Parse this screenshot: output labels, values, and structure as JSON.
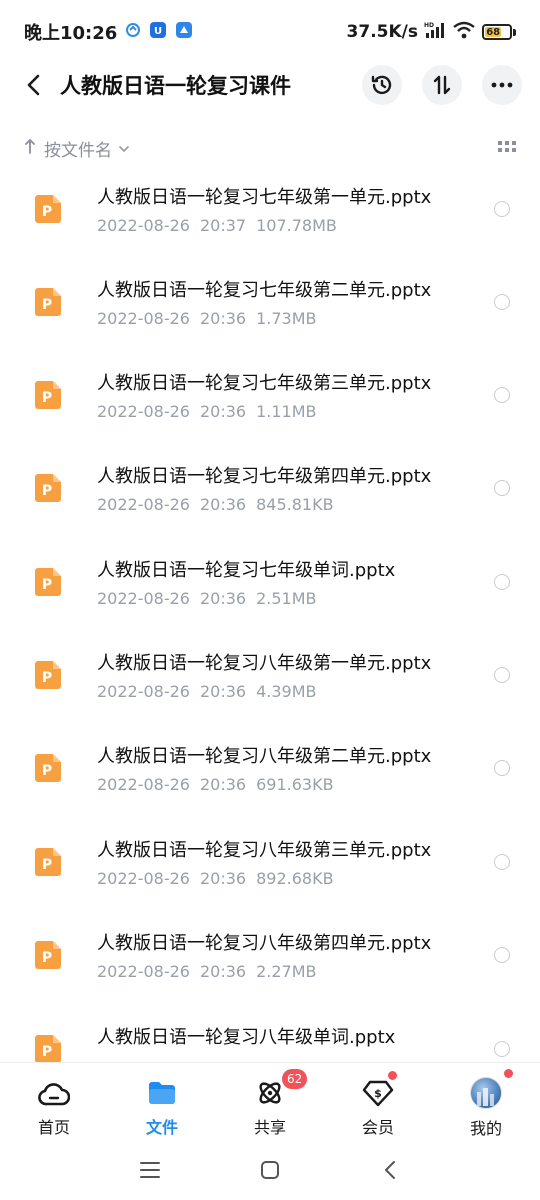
{
  "status_bar": {
    "time": "晚上10:26",
    "net_speed": "37.5K/s",
    "battery": "68"
  },
  "header": {
    "title": "人教版日语一轮复习课件"
  },
  "sort": {
    "label": "按文件名"
  },
  "files": [
    {
      "name": "人教版日语一轮复习七年级第一单元.pptx",
      "date": "2022-08-26",
      "time": "20:37",
      "size": "107.78MB"
    },
    {
      "name": "人教版日语一轮复习七年级第二单元.pptx",
      "date": "2022-08-26",
      "time": "20:36",
      "size": "1.73MB"
    },
    {
      "name": "人教版日语一轮复习七年级第三单元.pptx",
      "date": "2022-08-26",
      "time": "20:36",
      "size": "1.11MB"
    },
    {
      "name": "人教版日语一轮复习七年级第四单元.pptx",
      "date": "2022-08-26",
      "time": "20:36",
      "size": "845.81KB"
    },
    {
      "name": "人教版日语一轮复习七年级单词.pptx",
      "date": "2022-08-26",
      "time": "20:36",
      "size": "2.51MB"
    },
    {
      "name": "人教版日语一轮复习八年级第一单元.pptx",
      "date": "2022-08-26",
      "time": "20:36",
      "size": "4.39MB"
    },
    {
      "name": "人教版日语一轮复习八年级第二单元.pptx",
      "date": "2022-08-26",
      "time": "20:36",
      "size": "691.63KB"
    },
    {
      "name": "人教版日语一轮复习八年级第三单元.pptx",
      "date": "2022-08-26",
      "time": "20:36",
      "size": "892.68KB"
    },
    {
      "name": "人教版日语一轮复习八年级第四单元.pptx",
      "date": "2022-08-26",
      "time": "20:36",
      "size": "2.27MB"
    },
    {
      "name": "人教版日语一轮复习八年级单词.pptx",
      "date": "",
      "time": "",
      "size": ""
    }
  ],
  "file_icon_letter": "P",
  "bottom_nav": {
    "items": [
      {
        "label": "首页",
        "icon": "cloud-home-icon"
      },
      {
        "label": "文件",
        "icon": "folder-icon",
        "active": true
      },
      {
        "label": "共享",
        "icon": "share-atom-icon",
        "badge": "62"
      },
      {
        "label": "会员",
        "icon": "vip-diamond-icon",
        "dot": true
      },
      {
        "label": "我的",
        "icon": "avatar",
        "dot": true
      }
    ]
  },
  "colors": {
    "accent": "#1e8cf0",
    "file_icon": "#f7a042",
    "badge": "#f2515a"
  }
}
